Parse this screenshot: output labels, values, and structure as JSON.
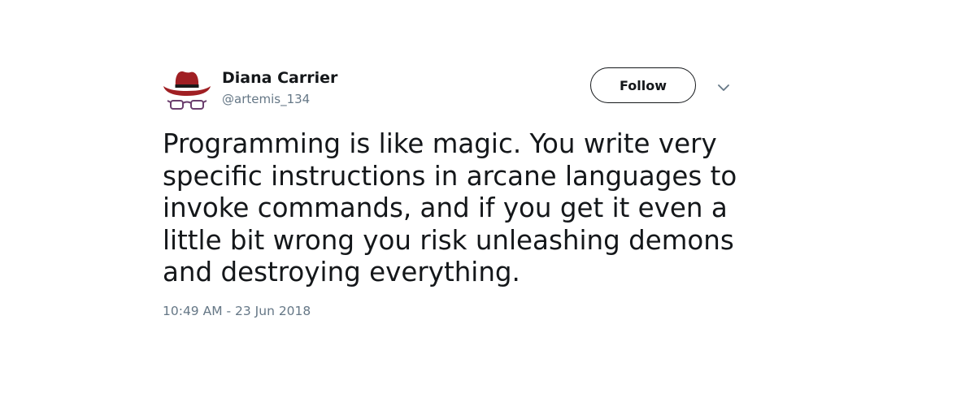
{
  "user": {
    "display_name": "Diana Carrier",
    "handle": "@artemis_134",
    "avatar_icon": "hat-and-glasses-icon"
  },
  "actions": {
    "follow_label": "Follow",
    "more_icon": "chevron-down-icon"
  },
  "tweet": {
    "lines": [
      "Programming is like magic. You write very",
      "specific instructions in arcane languages to",
      "invoke commands, and if you get it even a",
      "little bit wrong you risk unleashing demons",
      "and destroying everything."
    ],
    "timestamp": "10:49 AM - 23 Jun 2018"
  },
  "colors": {
    "text_primary": "#14171a",
    "text_secondary": "#657786",
    "hat_red": "#a01f23",
    "glasses_purple": "#6b3f6e"
  }
}
